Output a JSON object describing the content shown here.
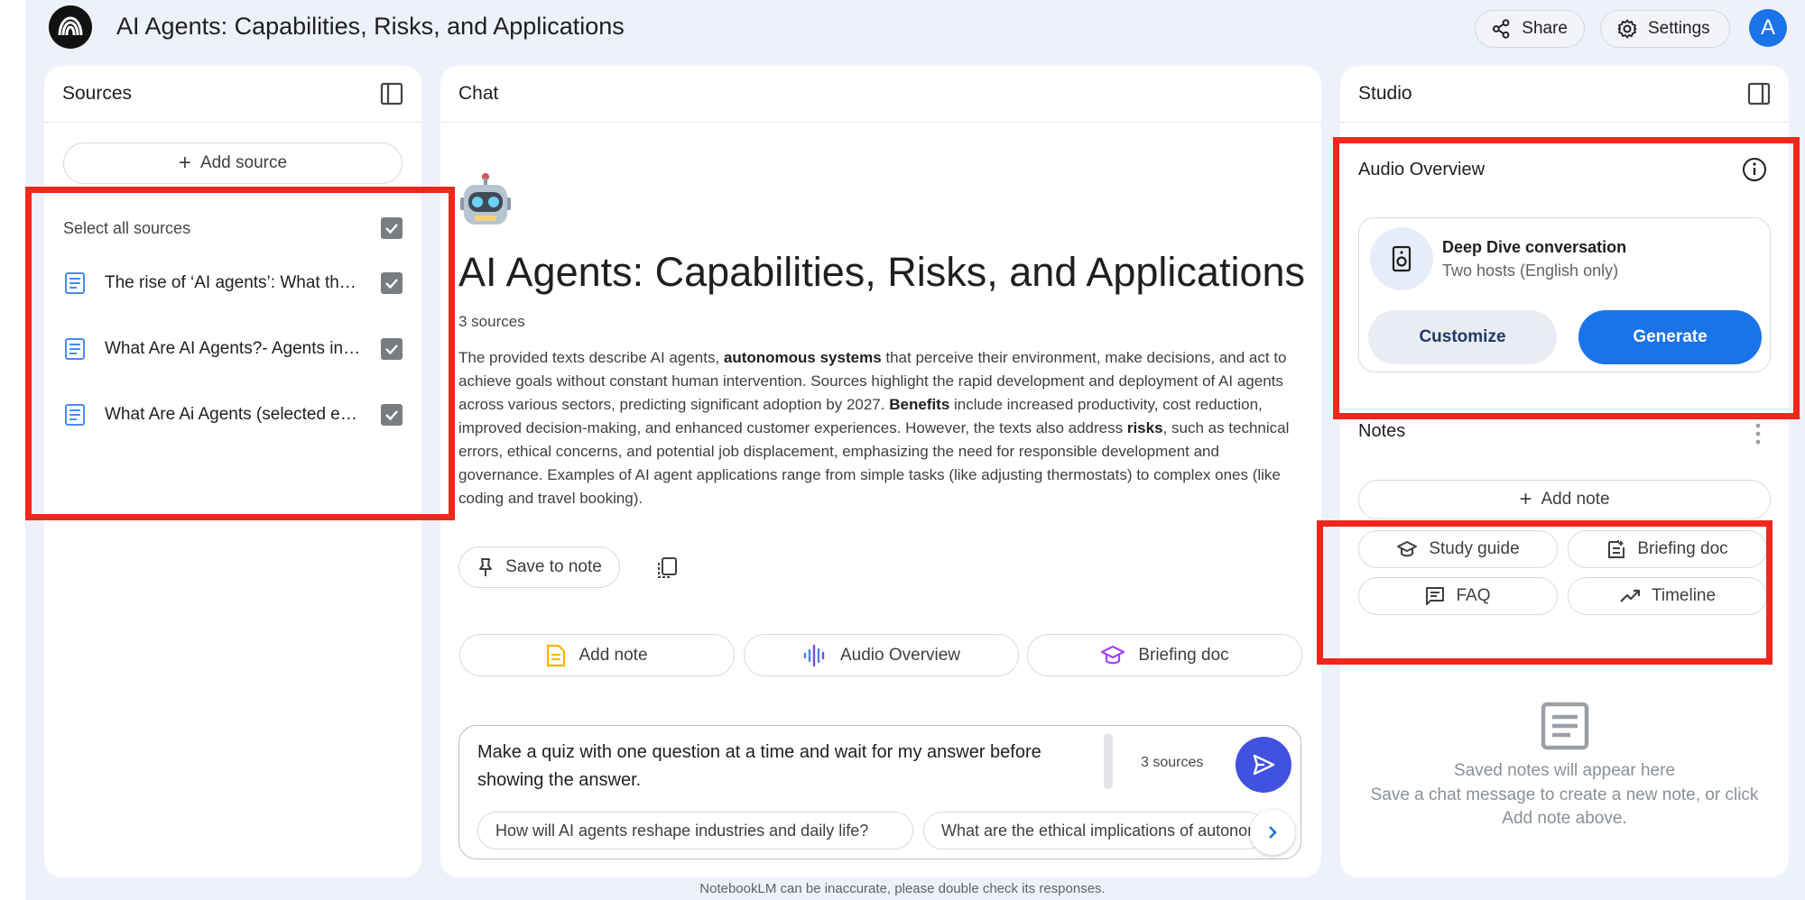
{
  "header": {
    "title": "AI Agents: Capabilities, Risks, and Applications",
    "share_label": "Share",
    "settings_label": "Settings",
    "avatar_letter": "A"
  },
  "sources": {
    "panel_title": "Sources",
    "add_source_label": "Add source",
    "select_all_label": "Select all sources",
    "items": [
      {
        "label": "The rise of ‘AI agents’: What they are and how to manage the risks",
        "checked": true
      },
      {
        "label": "What Are AI Agents?- Agents in Artificial Intelligence Explained",
        "checked": true
      },
      {
        "label": "What Are Ai Agents (selected excerpts)",
        "checked": true
      }
    ]
  },
  "chat": {
    "panel_title": "Chat",
    "notebook_title": "AI Agents: Capabilities, Risks, and Applications",
    "source_count": "3 sources",
    "summary_parts": [
      {
        "text": "The provided texts describe AI agents, ",
        "bold": false
      },
      {
        "text": "autonomous systems",
        "bold": true
      },
      {
        "text": " that perceive their environment, make decisions, and act to achieve goals without constant human intervention. Sources highlight the rapid development and deployment of AI agents across various sectors, predicting significant adoption by 2027. ",
        "bold": false
      },
      {
        "text": "Benefits",
        "bold": true
      },
      {
        "text": " include increased productivity, cost reduction, improved decision-making, and enhanced customer experiences. However, the texts also address ",
        "bold": false
      },
      {
        "text": "risks",
        "bold": true
      },
      {
        "text": ", such as technical errors, ethical concerns, and potential job displacement, emphasizing the need for responsible development and governance. Examples of AI agent applications range from simple tasks (like adjusting thermostats) to complex ones (like coding and travel booking).",
        "bold": false
      }
    ],
    "save_to_note_label": "Save to note",
    "actions": [
      {
        "label": "Add note",
        "icon": "note-icon"
      },
      {
        "label": "Audio Overview",
        "icon": "audio-wave-icon"
      },
      {
        "label": "Briefing doc",
        "icon": "graduation-cap-icon"
      }
    ],
    "input_text": "Make a quiz with one question at a time and wait for my answer before showing the answer.",
    "input_source_count": "3 sources",
    "suggestions": [
      "How will AI agents reshape industries and daily life?",
      "What are the ethical implications of autonomous AI agents?"
    ],
    "disclaimer": "NotebookLM can be inaccurate, please double check its responses."
  },
  "studio": {
    "panel_title": "Studio",
    "audio_overview_title": "Audio Overview",
    "audio_card": {
      "name": "Deep Dive conversation",
      "description": "Two hosts (English only)",
      "customize_label": "Customize",
      "generate_label": "Generate"
    },
    "notes_title": "Notes",
    "add_note_label": "Add note",
    "chips": [
      {
        "label": "Study guide",
        "icon": "graduation-cap-icon"
      },
      {
        "label": "Briefing doc",
        "icon": "document-list-icon"
      },
      {
        "label": "FAQ",
        "icon": "chat-list-icon"
      },
      {
        "label": "Timeline",
        "icon": "trend-icon"
      }
    ],
    "empty_title": "Saved notes will appear here",
    "empty_desc": "Save a chat message to create a new note, or click Add note above."
  },
  "colors": {
    "accent_blue": "#1a73e8",
    "send_button": "#4152e0",
    "highlight_red": "#f2261b",
    "background": "#eef1f9"
  }
}
